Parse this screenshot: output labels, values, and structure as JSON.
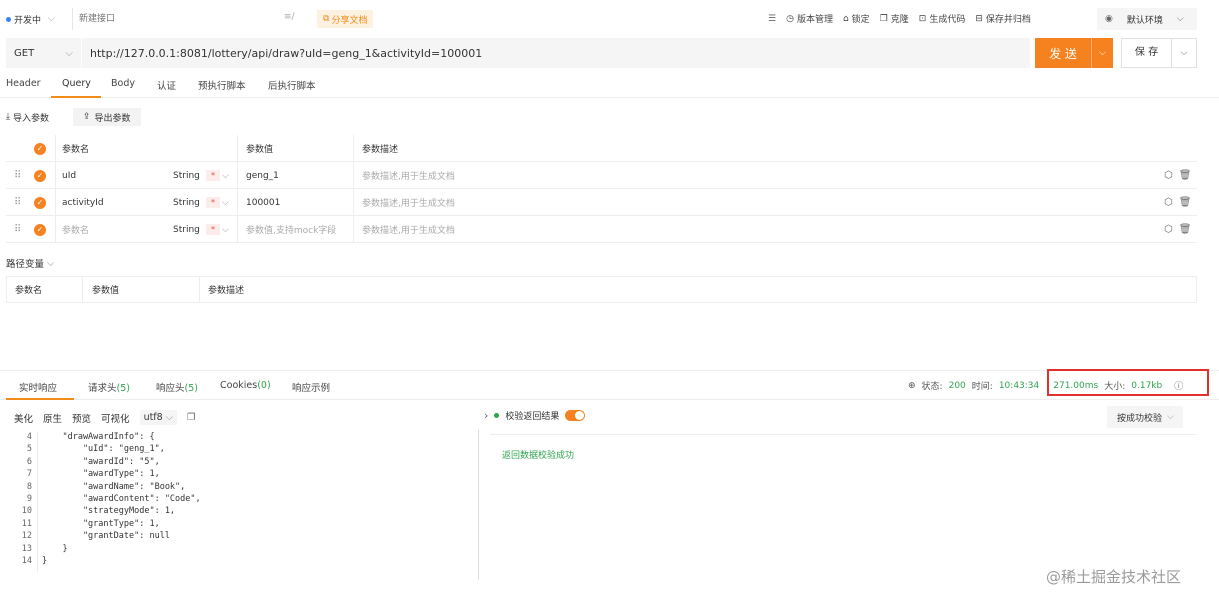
{
  "top": {
    "status": "开发中",
    "name_placeholder": "新建接口",
    "name_icon": "≡∕",
    "share": "分享文档",
    "actions": [
      "版本管理",
      "锁定",
      "克隆",
      "生成代码",
      "保存并归档"
    ],
    "environment": "默认环境"
  },
  "request": {
    "method": "GET",
    "url": "http://127.0.0.1:8081/lottery/api/draw?uId=geng_1&activityId=100001",
    "send": "发 送",
    "save": "保 存",
    "tabs": [
      "Header",
      "Query",
      "Body",
      "认证",
      "预执行脚本",
      "后执行脚本"
    ],
    "active_tab": "Query"
  },
  "query": {
    "import": "导入参数",
    "export": "导出参数",
    "headers": [
      "参数名",
      "参数值",
      "参数描述"
    ],
    "rows": [
      {
        "name": "uId",
        "type": "String",
        "required": "*",
        "value": "geng_1",
        "desc": "参数描述,用于生成文档"
      },
      {
        "name": "activityId",
        "type": "String",
        "required": "*",
        "value": "100001",
        "desc": "参数描述,用于生成文档"
      },
      {
        "name": "参数名",
        "type": "String",
        "required": "*",
        "value": "参数值,支持mock字段",
        "desc": "参数描述,用于生成文档"
      }
    ]
  },
  "path_vars": {
    "title": "路径变量",
    "headers": [
      "参数名",
      "参数值",
      "参数描述"
    ]
  },
  "response": {
    "tabs": [
      {
        "label": "实时响应",
        "count": ""
      },
      {
        "label": "请求头",
        "count": "(5)"
      },
      {
        "label": "响应头",
        "count": "(5)"
      },
      {
        "label": "Cookies",
        "count": "(0)"
      },
      {
        "label": "响应示例",
        "count": ""
      }
    ],
    "status_label": "状态:",
    "status": "200",
    "time_label": "时间:",
    "time": "10:43:34",
    "duration": "271.00ms",
    "size_label": "大小:",
    "size": "0.17kb",
    "toolbar": [
      "美化",
      "原生",
      "预览",
      "可视化"
    ],
    "encoding": "utf8",
    "code": [
      {
        "n": "4",
        "t": "    \"drawAwardInfo\": {"
      },
      {
        "n": "5",
        "t": "        \"uId\": \"geng_1\","
      },
      {
        "n": "6",
        "t": "        \"awardId\": \"5\","
      },
      {
        "n": "7",
        "t": "        \"awardType\": 1,"
      },
      {
        "n": "8",
        "t": "        \"awardName\": \"Book\","
      },
      {
        "n": "9",
        "t": "        \"awardContent\": \"Code\","
      },
      {
        "n": "10",
        "t": "        \"strategyMode\": 1,"
      },
      {
        "n": "11",
        "t": "        \"grantType\": 1,"
      },
      {
        "n": "12",
        "t": "        \"grantDate\": null"
      },
      {
        "n": "13",
        "t": "    }"
      },
      {
        "n": "14",
        "t": "}"
      }
    ],
    "validate_label": "校验返回结果",
    "validate_result": "返回数据校验成功",
    "validate_mode": "按成功校验"
  },
  "watermark": "@稀土掘金技术社区"
}
